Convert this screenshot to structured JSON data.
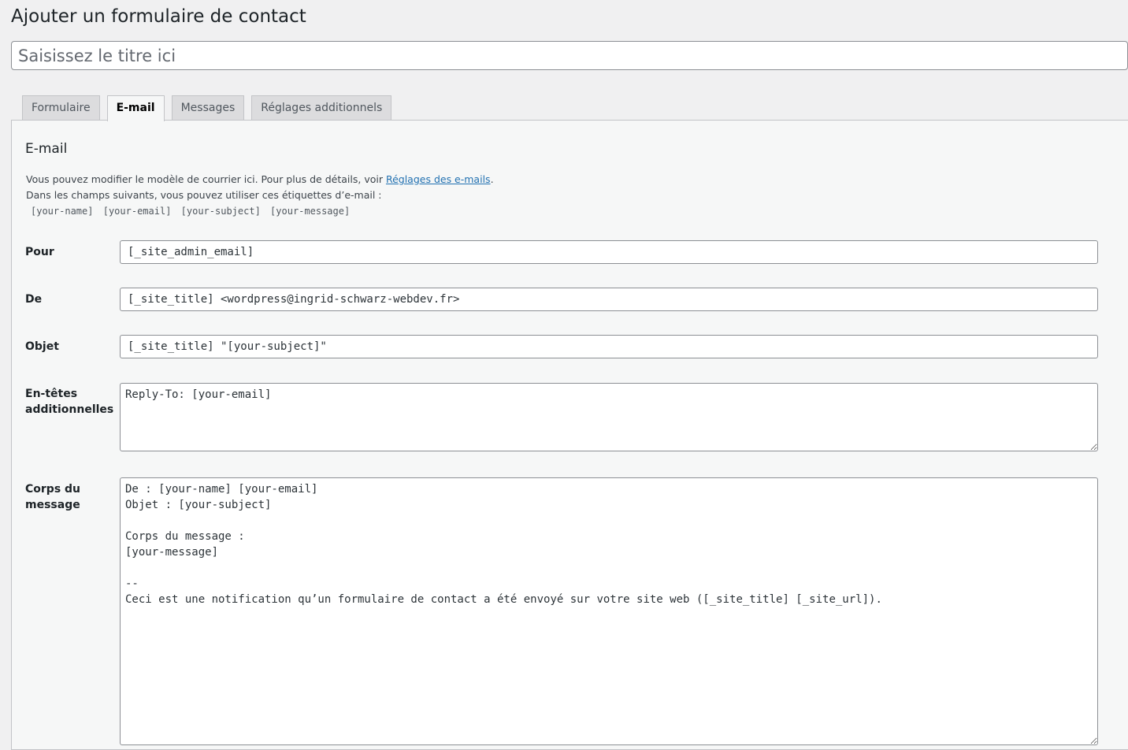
{
  "page": {
    "title": "Ajouter un formulaire de contact",
    "title_placeholder": "Saisissez le titre ici"
  },
  "tabs": [
    {
      "label": "Formulaire",
      "active": false
    },
    {
      "label": "E-mail",
      "active": true
    },
    {
      "label": "Messages",
      "active": false
    },
    {
      "label": "Réglages additionnels",
      "active": false
    }
  ],
  "email_panel": {
    "heading": "E-mail",
    "description_1_before_link": "Vous pouvez modifier le modèle de courrier ici. Pour plus de détails, voir ",
    "description_1_link": "Réglages des e-mails",
    "description_1_after_link": ".",
    "description_2": "Dans les champs suivants, vous pouvez utiliser ces étiquettes d’e-mail :",
    "mail_tags": [
      "[your-name]",
      "[your-email]",
      "[your-subject]",
      "[your-message]"
    ],
    "fields": {
      "to": {
        "label": "Pour",
        "value": "[_site_admin_email]"
      },
      "from": {
        "label": "De",
        "value": "[_site_title] <wordpress@ingrid-schwarz-webdev.fr>"
      },
      "subject": {
        "label": "Objet",
        "value": "[_site_title] \"[your-subject]\""
      },
      "headers": {
        "label_line1": "En-têtes",
        "label_line2": "additionnelles",
        "value": "Reply-To: [your-email]"
      },
      "body": {
        "label_line1": "Corps du",
        "label_line2": "message",
        "value": "De : [your-name] [your-email]\nObjet : [your-subject]\n\nCorps du message :\n[your-message]\n\n-- \nCeci est une notification qu’un formulaire de contact a été envoyé sur votre site web ([_site_title] [_site_url])."
      }
    }
  },
  "colors": {
    "background": "#f0f0f1",
    "panel": "#f6f7f7",
    "link": "#2271b1",
    "border": "#8c8f94"
  }
}
